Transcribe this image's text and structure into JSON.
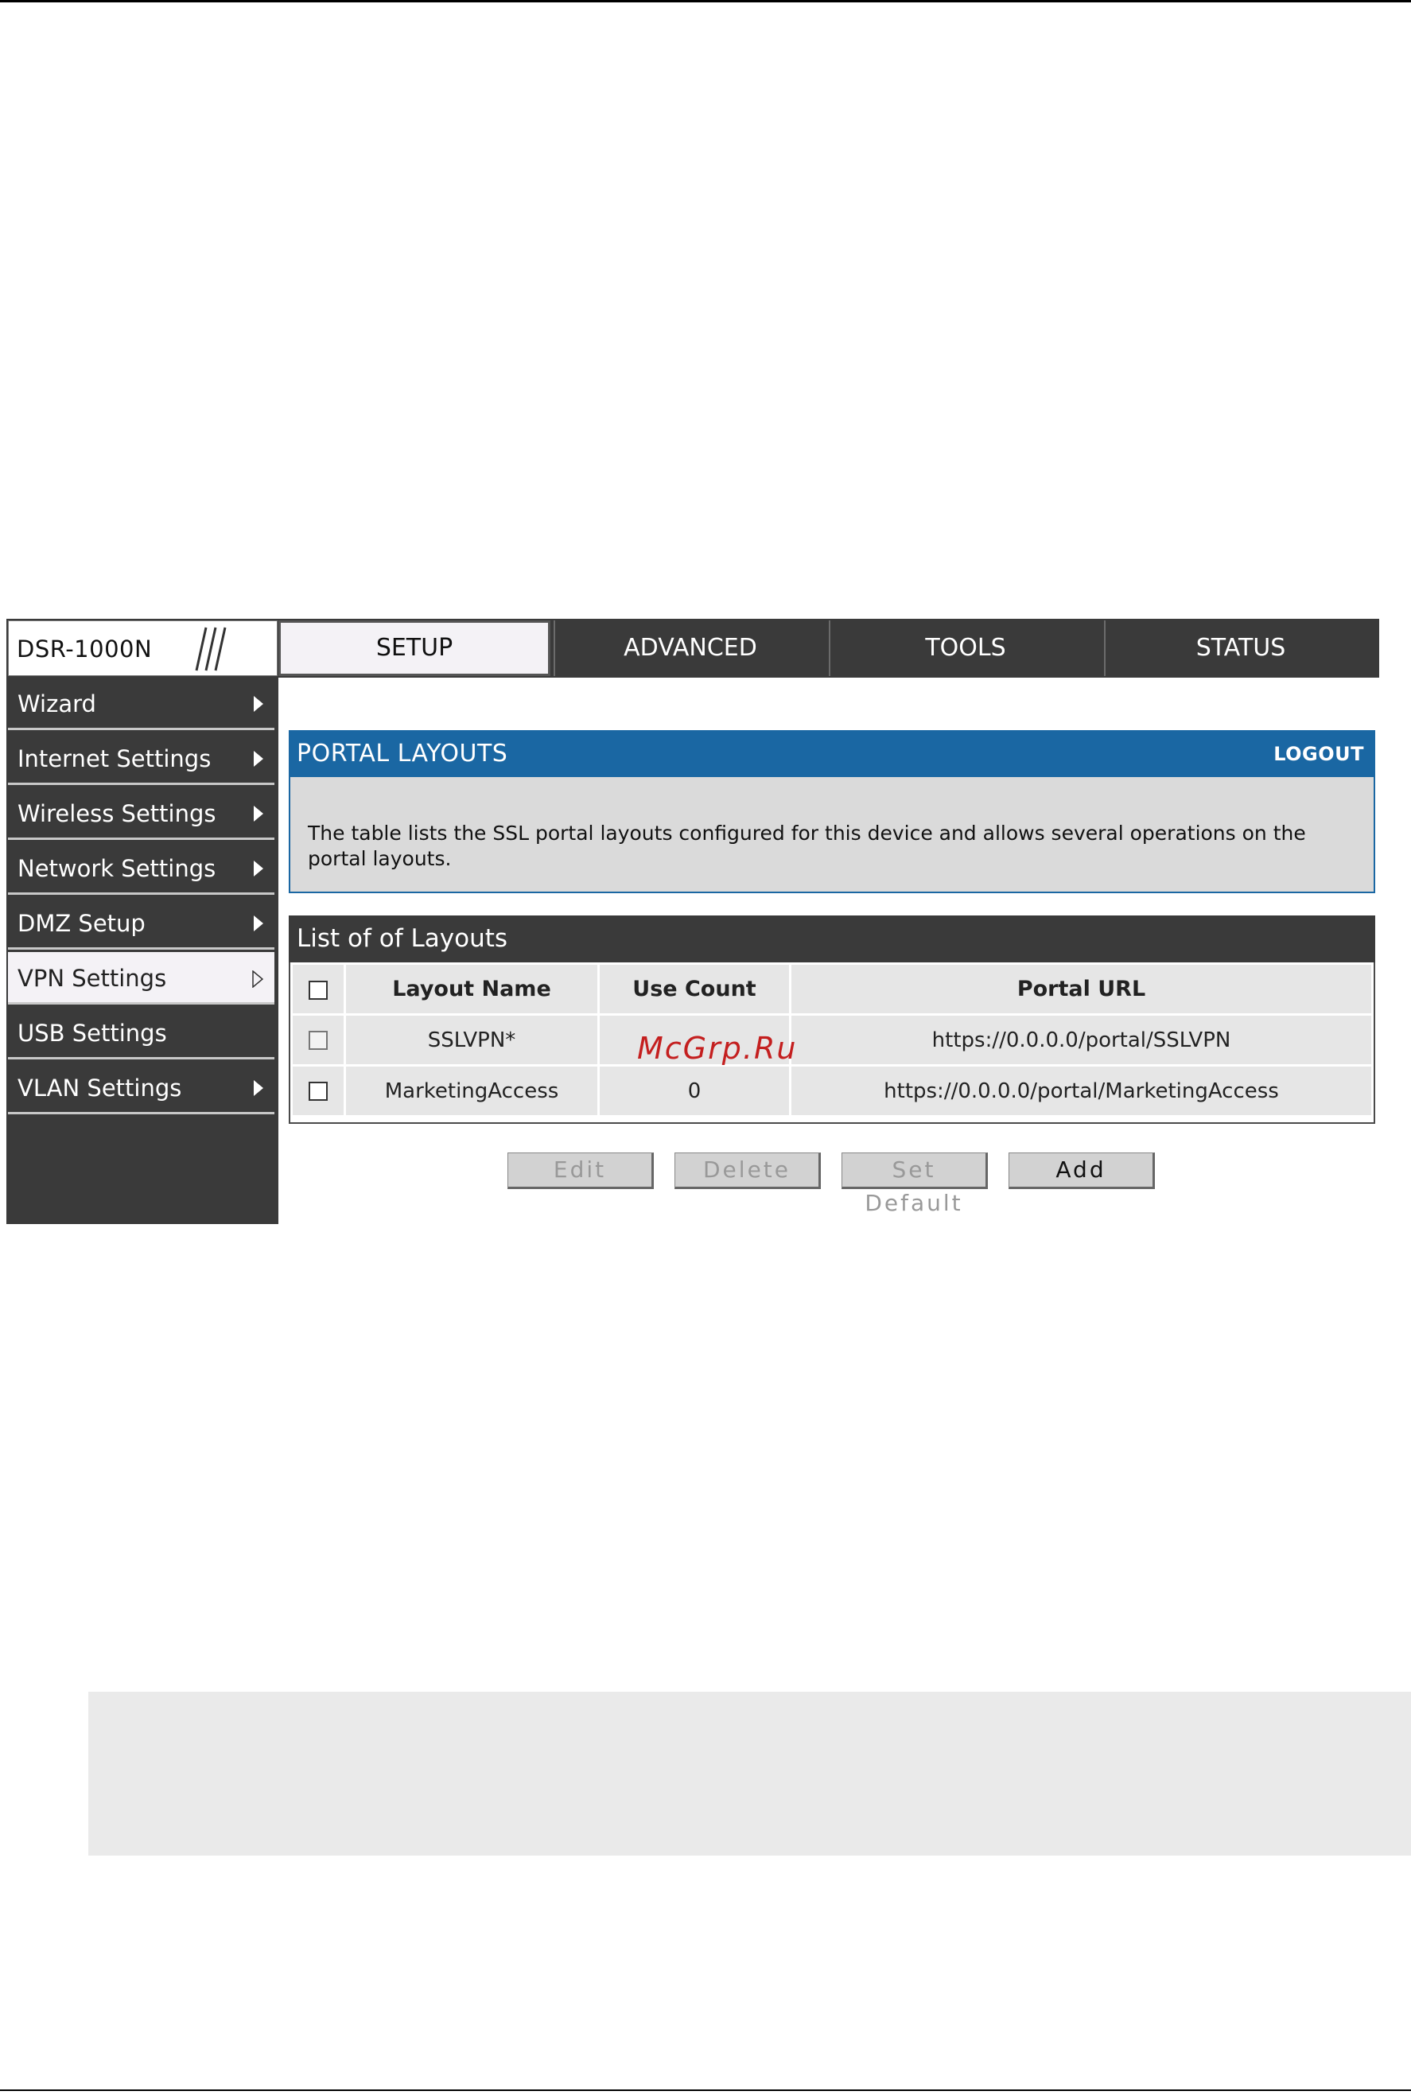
{
  "device": {
    "model": "DSR-1000N"
  },
  "nav": {
    "tabs": [
      {
        "label": "SETUP",
        "active": true
      },
      {
        "label": "ADVANCED",
        "active": false
      },
      {
        "label": "TOOLS",
        "active": false
      },
      {
        "label": "STATUS",
        "active": false
      }
    ]
  },
  "sidebar": {
    "items": [
      {
        "label": "Wizard",
        "active": false
      },
      {
        "label": "Internet Settings",
        "active": false
      },
      {
        "label": "Wireless Settings",
        "active": false
      },
      {
        "label": "Network Settings",
        "active": false
      },
      {
        "label": "DMZ Setup",
        "active": false
      },
      {
        "label": "VPN Settings",
        "active": true
      },
      {
        "label": "USB Settings",
        "active": false
      },
      {
        "label": "VLAN Settings",
        "active": false
      }
    ]
  },
  "panel": {
    "title": "PORTAL LAYOUTS",
    "logout": "LOGOUT",
    "description": "The table lists the SSL portal layouts configured for this device and allows several operations on the portal layouts."
  },
  "layouts": {
    "title": "List of of Layouts",
    "columns": [
      "Layout Name",
      "Use Count",
      "Portal URL"
    ],
    "rows": [
      {
        "name": "SSLVPN*",
        "use_count": "",
        "url": "https://0.0.0.0/portal/SSLVPN",
        "checkbox_disabled": true
      },
      {
        "name": "MarketingAccess",
        "use_count": "0",
        "url": "https://0.0.0.0/portal/MarketingAccess",
        "checkbox_disabled": false
      }
    ]
  },
  "watermark": "McGrp.Ru",
  "buttons": {
    "edit": {
      "label": "Edit",
      "enabled": false
    },
    "delete": {
      "label": "Delete",
      "enabled": false
    },
    "set_default": {
      "label": "Set Default",
      "enabled": false
    },
    "add": {
      "label": "Add",
      "enabled": true
    }
  },
  "colors": {
    "header_bar": "#3a3a3a",
    "panel_blue": "#1a67a3",
    "panel_body": "#dadada",
    "table_cell": "#e6e6e6",
    "watermark_red": "#c41f1f",
    "note_box": "#eaeaea"
  }
}
